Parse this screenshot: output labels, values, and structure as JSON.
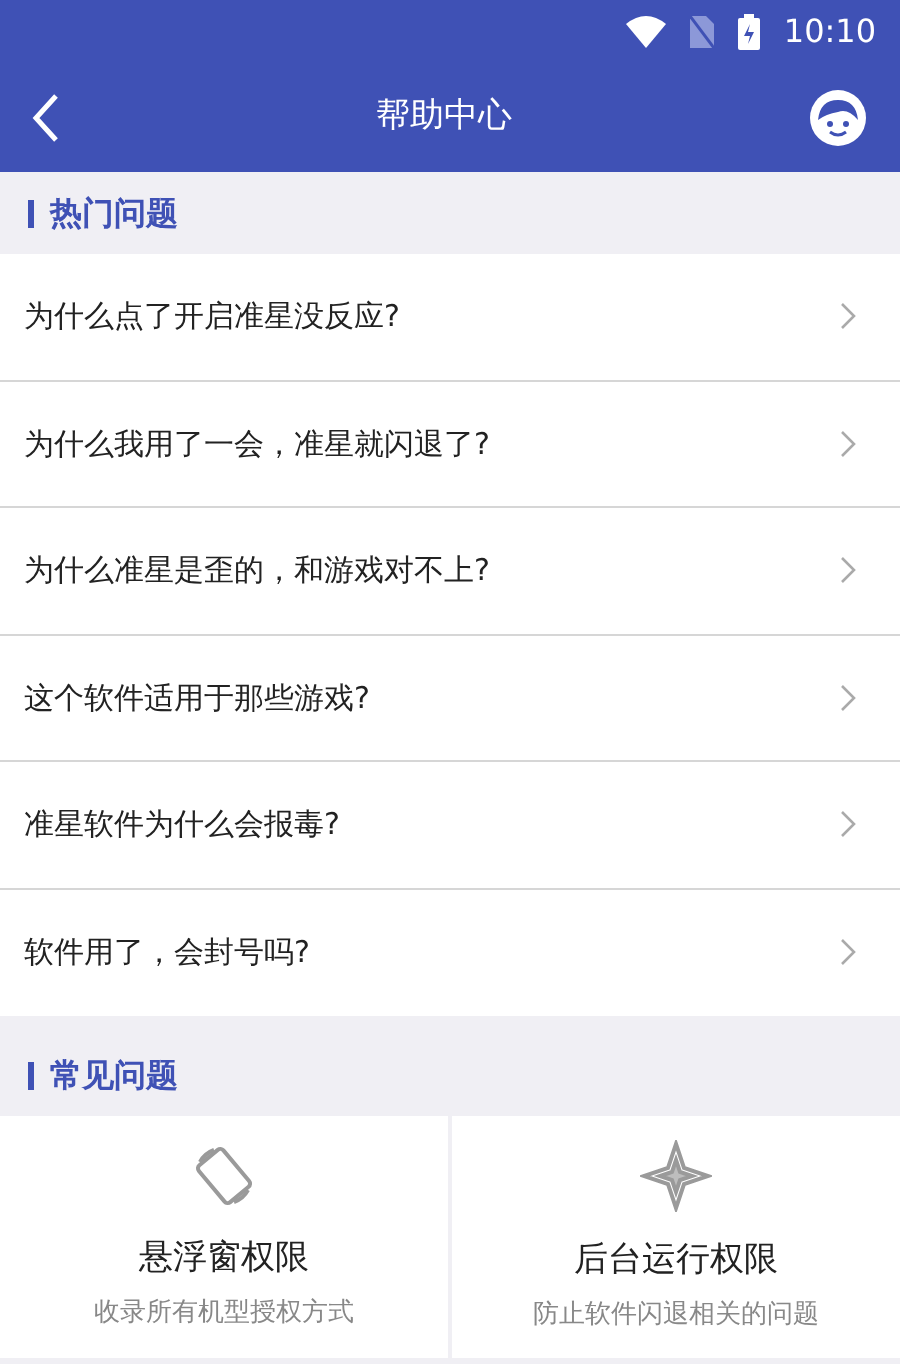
{
  "status_bar": {
    "time": "10:10"
  },
  "header": {
    "title": "帮助中心"
  },
  "hot_section": {
    "title": "热门问题",
    "items": [
      {
        "text": "为什么点了开启准星没反应?"
      },
      {
        "text": "为什么我用了一会，准星就闪退了?"
      },
      {
        "text": "为什么准星是歪的，和游戏对不上?"
      },
      {
        "text": "这个软件适用于那些游戏?"
      },
      {
        "text": "准星软件为什么会报毒?"
      },
      {
        "text": "软件用了，会封号吗?"
      }
    ]
  },
  "common_section": {
    "title": "常见问题",
    "cards": [
      {
        "kind": "rotate",
        "title": "悬浮窗权限",
        "subtitle": "收录所有机型授权方式"
      },
      {
        "kind": "star",
        "title": "后台运行权限",
        "subtitle": "防止软件闪退相关的问题"
      }
    ]
  }
}
